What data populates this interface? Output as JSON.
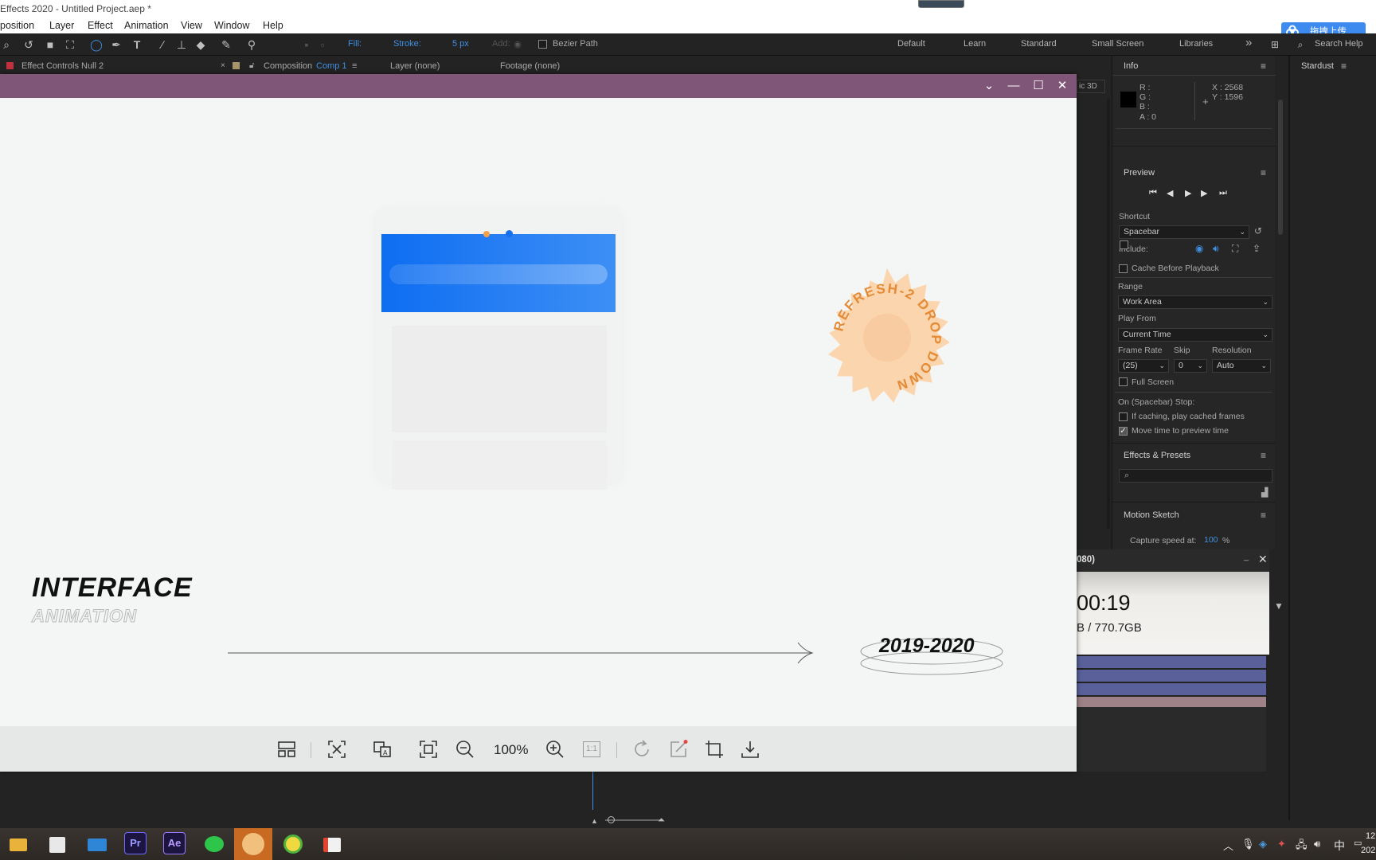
{
  "titlebar": {
    "title": "Effects 2020 - Untitled Project.aep *"
  },
  "menubar": {
    "items": [
      "position",
      "Layer",
      "Effect",
      "Animation",
      "View",
      "Window",
      "Help"
    ]
  },
  "upload_widget": {
    "label": "拖拽上传"
  },
  "toolbar": {
    "fill_label": "Fill:",
    "stroke_label": "Stroke:",
    "stroke_width": "5 px",
    "add_label": "Add:",
    "bezier_label": "Bezier Path",
    "workspaces": [
      "Default",
      "Learn",
      "Standard",
      "Small Screen",
      "Libraries"
    ],
    "more_glyph": "»",
    "search_placeholder": "Search Help"
  },
  "panel_tabs": {
    "effect_controls": "Effect Controls Null 2",
    "composition_prefix": "Composition",
    "composition_name": "Comp 1",
    "layer": "Layer (none)",
    "footage": "Footage (none)",
    "renderer_fragment": "ic 3D"
  },
  "info_panel": {
    "title": "Info",
    "r_label": "R :",
    "g_label": "G :",
    "b_label": "B :",
    "a_label": "A : 0",
    "x_label": "X : 2568",
    "y_label": "Y : 1596"
  },
  "preview_panel": {
    "title": "Preview",
    "shortcut_label": "Shortcut",
    "shortcut_value": "Spacebar",
    "include_label": "Include:",
    "cache_label": "Cache Before Playback",
    "range_label": "Range",
    "range_value": "Work Area",
    "play_from_label": "Play From",
    "play_from_value": "Current Time",
    "frame_rate_label": "Frame Rate",
    "skip_label": "Skip",
    "resolution_label": "Resolution",
    "frame_rate_value": "(25)",
    "skip_value": "0",
    "resolution_value": "Auto",
    "fullscreen_label": "Full Screen",
    "stop_label": "On (Spacebar) Stop:",
    "if_caching_label": "If caching, play cached frames",
    "move_time_label": "Move time to preview time",
    "move_time_checked": true
  },
  "effects_panel": {
    "title": "Effects & Presets",
    "search_placeholder": ""
  },
  "motion_sketch_panel": {
    "title": "Motion Sketch",
    "capture_label": "Capture speed at:",
    "capture_value": "100",
    "capture_unit": "%"
  },
  "stardust_panel": {
    "title": "Stardust"
  },
  "viewer": {
    "interface_title": "INTERFACE",
    "animation_subtitle": "ANIMATION",
    "year_range": "2019-2020",
    "badge_text": "REFRESH-2 DROP DOWN",
    "zoom_level": "100%",
    "actual_size_label": "1:1"
  },
  "timer_widget": {
    "header_fragment": "080)",
    "time": "00:19",
    "storage": "B / 770.7GB"
  },
  "taskbar": {
    "apps": [
      "file-explorer",
      "store",
      "mail",
      "Pr",
      "Ae",
      "wechat",
      "avatar-app",
      "green-app",
      "red-app"
    ],
    "ime": "中",
    "clock_time": "12",
    "clock_date": "202"
  }
}
